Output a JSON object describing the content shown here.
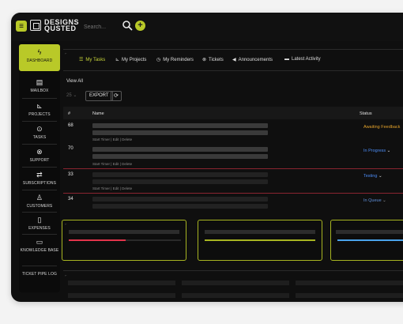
{
  "brand": {
    "line1": "DESIGNS",
    "line2": "QUSTED"
  },
  "search": {
    "placeholder": "Search..."
  },
  "sidebar": {
    "items": [
      {
        "label": "DASHBOARD",
        "icon": "bolt-icon"
      },
      {
        "label": "MAILBOX",
        "icon": "mailbox-icon"
      },
      {
        "label": "PROJECTS",
        "icon": "projects-icon"
      },
      {
        "label": "TASKS",
        "icon": "tasks-icon"
      },
      {
        "label": "SUPPORT",
        "icon": "support-icon"
      },
      {
        "label": "SUBSCRIPTIONS",
        "icon": "subscriptions-icon"
      },
      {
        "label": "CUSTOMERS",
        "icon": "customers-icon"
      },
      {
        "label": "EXPENSES",
        "icon": "expenses-icon"
      },
      {
        "label": "KNOWLEDGE BASE",
        "icon": "knowledge-icon"
      },
      {
        "label": "TICKET PIPE LOG",
        "icon": ""
      }
    ]
  },
  "tabs": [
    {
      "label": "My Tasks",
      "icon": "list-icon"
    },
    {
      "label": "My Projects",
      "icon": "projects-icon"
    },
    {
      "label": "My Reminders",
      "icon": "clock-icon"
    },
    {
      "label": "Tickets",
      "icon": "ticket-icon"
    },
    {
      "label": "Announcements",
      "icon": "megaphone-icon"
    },
    {
      "label": "Latest Activity",
      "icon": "activity-icon"
    }
  ],
  "tasks": {
    "view_all": "View All",
    "page_length": "25",
    "export_label": "EXPORT",
    "columns": {
      "num": "#",
      "name": "Name",
      "status": "Status"
    },
    "rows": [
      {
        "num": "68",
        "actions": "Start Timer | Edit | Delete",
        "status": "Awaiting Feedback"
      },
      {
        "num": "70",
        "actions": "Start Timer | Edit | Delete",
        "status": "In Progress"
      },
      {
        "num": "33",
        "actions": "Start Timer | Edit | Delete",
        "status": "Testing"
      },
      {
        "num": "34",
        "actions": "",
        "status": "In Queue"
      }
    ]
  },
  "colors": {
    "accent": "#b9c928",
    "status_awaiting": "#e2a12b",
    "status_progress": "#4c8cf5",
    "status_testing": "#4c8cf5",
    "status_queue": "#5f8fd8",
    "card_red": "#e2344b",
    "card_olive": "#a7b421",
    "card_blue": "#4aa3ea"
  }
}
